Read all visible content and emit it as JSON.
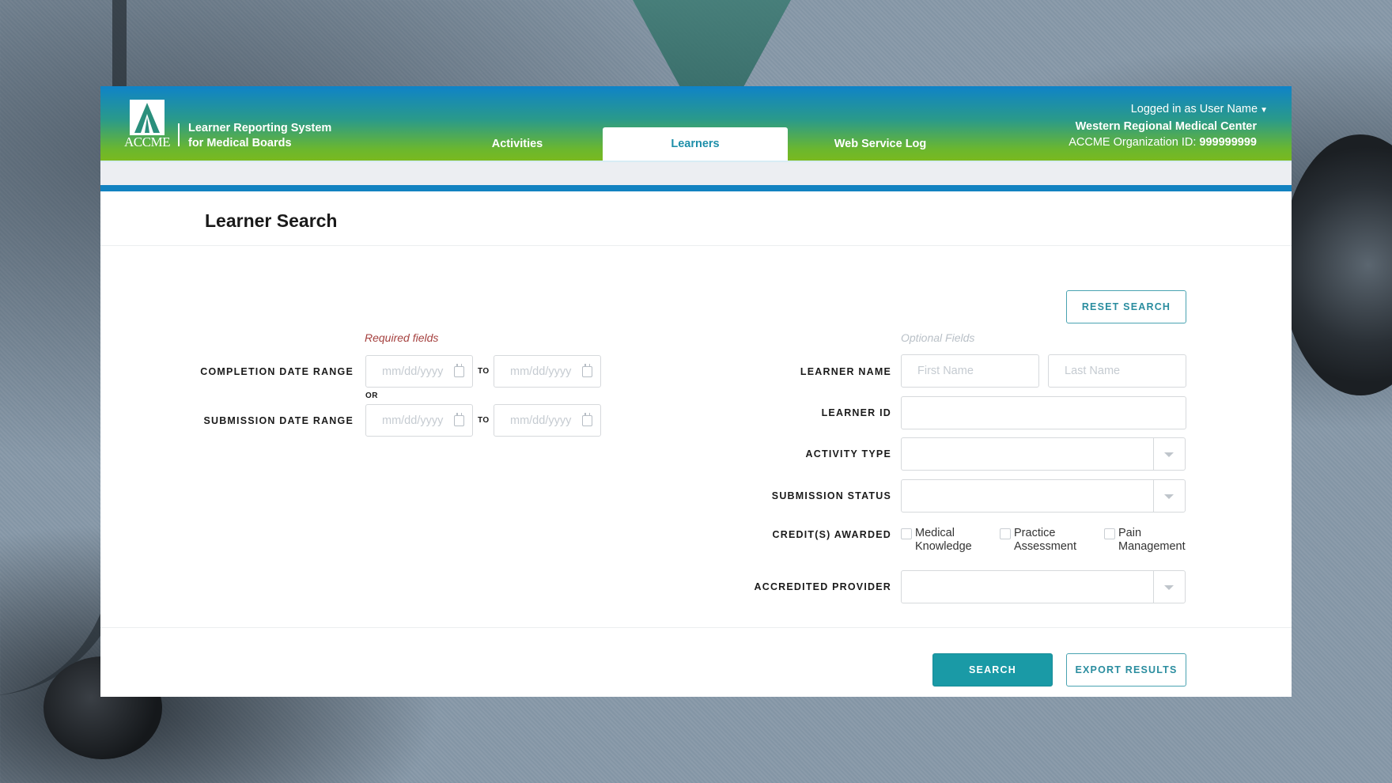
{
  "header": {
    "logo_text": "ACCME",
    "app_title_line1": "Learner Reporting System",
    "app_title_line2": "for Medical Boards",
    "tabs": [
      {
        "label": "Activities",
        "active": false
      },
      {
        "label": "Learners",
        "active": true
      },
      {
        "label": "Web Service Log",
        "active": false
      }
    ],
    "user": {
      "logged_in_label": "Logged in as User Name",
      "organization": "Western Regional Medical Center",
      "org_id_label": "ACCME Organization ID:",
      "org_id_value": "999999999"
    }
  },
  "page": {
    "title": "Learner Search"
  },
  "form": {
    "required_hint": "Required fields",
    "optional_hint": "Optional Fields",
    "completion_date_range": {
      "label": "COMPLETION DATE RANGE",
      "from_placeholder": "mm/dd/yyyy",
      "to_label": "TO",
      "to_placeholder": "mm/dd/yyyy"
    },
    "or_label": "OR",
    "submission_date_range": {
      "label": "SUBMISSION DATE RANGE",
      "from_placeholder": "mm/dd/yyyy",
      "to_label": "TO",
      "to_placeholder": "mm/dd/yyyy"
    },
    "learner_name": {
      "label": "LEARNER NAME",
      "first_placeholder": "First Name",
      "last_placeholder": "Last Name",
      "first_value": "",
      "last_value": ""
    },
    "learner_id": {
      "label": "LEARNER ID",
      "value": ""
    },
    "activity_type": {
      "label": "ACTIVITY TYPE",
      "selected": ""
    },
    "submission_status": {
      "label": "SUBMISSION STATUS",
      "selected": ""
    },
    "credits_awarded": {
      "label": "CREDIT(S) AWARDED",
      "options": [
        {
          "line1": "Medical",
          "line2": "Knowledge",
          "checked": false
        },
        {
          "line1": "Practice",
          "line2": "Assessment",
          "checked": false
        },
        {
          "line1": "Pain",
          "line2": "Management",
          "checked": false
        }
      ]
    },
    "accredited_provider": {
      "label": "ACCREDITED PROVIDER",
      "selected": ""
    }
  },
  "buttons": {
    "reset": "RESET SEARCH",
    "search": "SEARCH",
    "export": "EXPORT RESULTS"
  },
  "colors": {
    "accent": "#1a9aa6",
    "header_blue": "#0f83c8",
    "header_green": "#7ab91f",
    "required_hint": "#a5413f"
  }
}
